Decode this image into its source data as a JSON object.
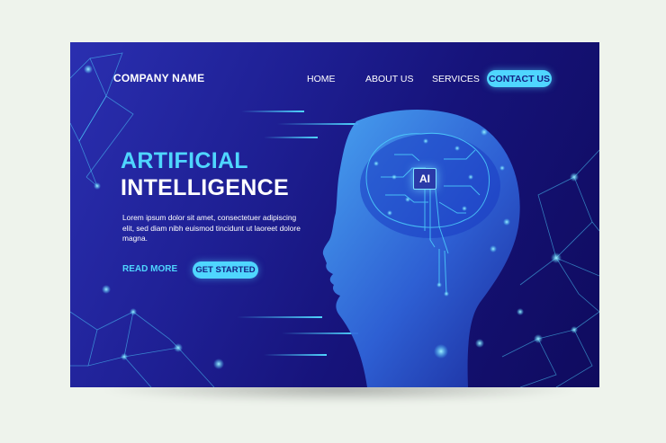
{
  "nav": {
    "brand": "COMPANY NAME",
    "home": "HOME",
    "about": "ABOUT US",
    "services": "SERVICES",
    "contact": "CONTACT US"
  },
  "hero": {
    "title_line1": "ARTIFICIAL",
    "title_line2": "INTELLIGENCE",
    "body": "Lorem ipsum dolor sit amet, consectetuer adipiscing elit, sed diam nibh euismod tincidunt ut laoreet dolore magna.",
    "read_more": "READ MORE",
    "get_started": "GET STARTED"
  },
  "illustration": {
    "chip_label": "AI"
  },
  "colors": {
    "accent": "#4fd6ff",
    "background_start": "#2a2fb0",
    "background_end": "#0f0b5e",
    "text": "#ffffff"
  }
}
